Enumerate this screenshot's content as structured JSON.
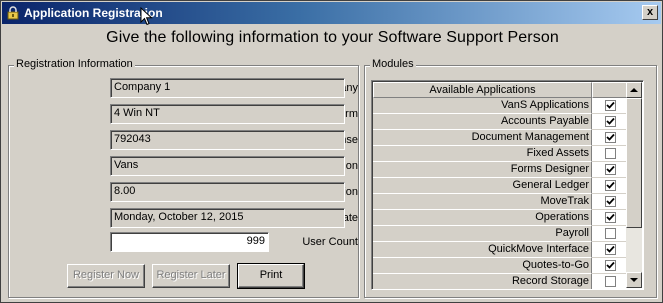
{
  "window": {
    "title": "Application Registration",
    "close_label": "x"
  },
  "headline": "Give the following information to your Software Support Person",
  "registration": {
    "legend": "Registration Information",
    "fields": [
      {
        "label": "Company",
        "value": "Company 1"
      },
      {
        "label": "Platform",
        "value": "4  Win NT"
      },
      {
        "label": "License",
        "value": "792043"
      },
      {
        "label": "Application",
        "value": "Vans"
      },
      {
        "label": "Revision",
        "value": "8.00"
      },
      {
        "label": "Registration Date",
        "value": "Monday, October 12, 2015"
      }
    ],
    "user_count_label": "User Count",
    "user_count_value": "999"
  },
  "buttons": {
    "register_now": "Register Now",
    "register_later": "Register Later",
    "print": "Print"
  },
  "modules": {
    "legend": "Modules",
    "header": "Available Applications",
    "items": [
      {
        "name": "VanS Applications",
        "checked": true
      },
      {
        "name": "Accounts Payable",
        "checked": true
      },
      {
        "name": "Document Management",
        "checked": true
      },
      {
        "name": "Fixed Assets",
        "checked": false
      },
      {
        "name": "Forms Designer",
        "checked": true
      },
      {
        "name": "General Ledger",
        "checked": true
      },
      {
        "name": "MoveTrak",
        "checked": true
      },
      {
        "name": "Operations",
        "checked": true
      },
      {
        "name": "Payroll",
        "checked": false
      },
      {
        "name": "QuickMove Interface",
        "checked": true
      },
      {
        "name": "Quotes-to-Go",
        "checked": true
      },
      {
        "name": "Record Storage",
        "checked": false
      }
    ]
  }
}
